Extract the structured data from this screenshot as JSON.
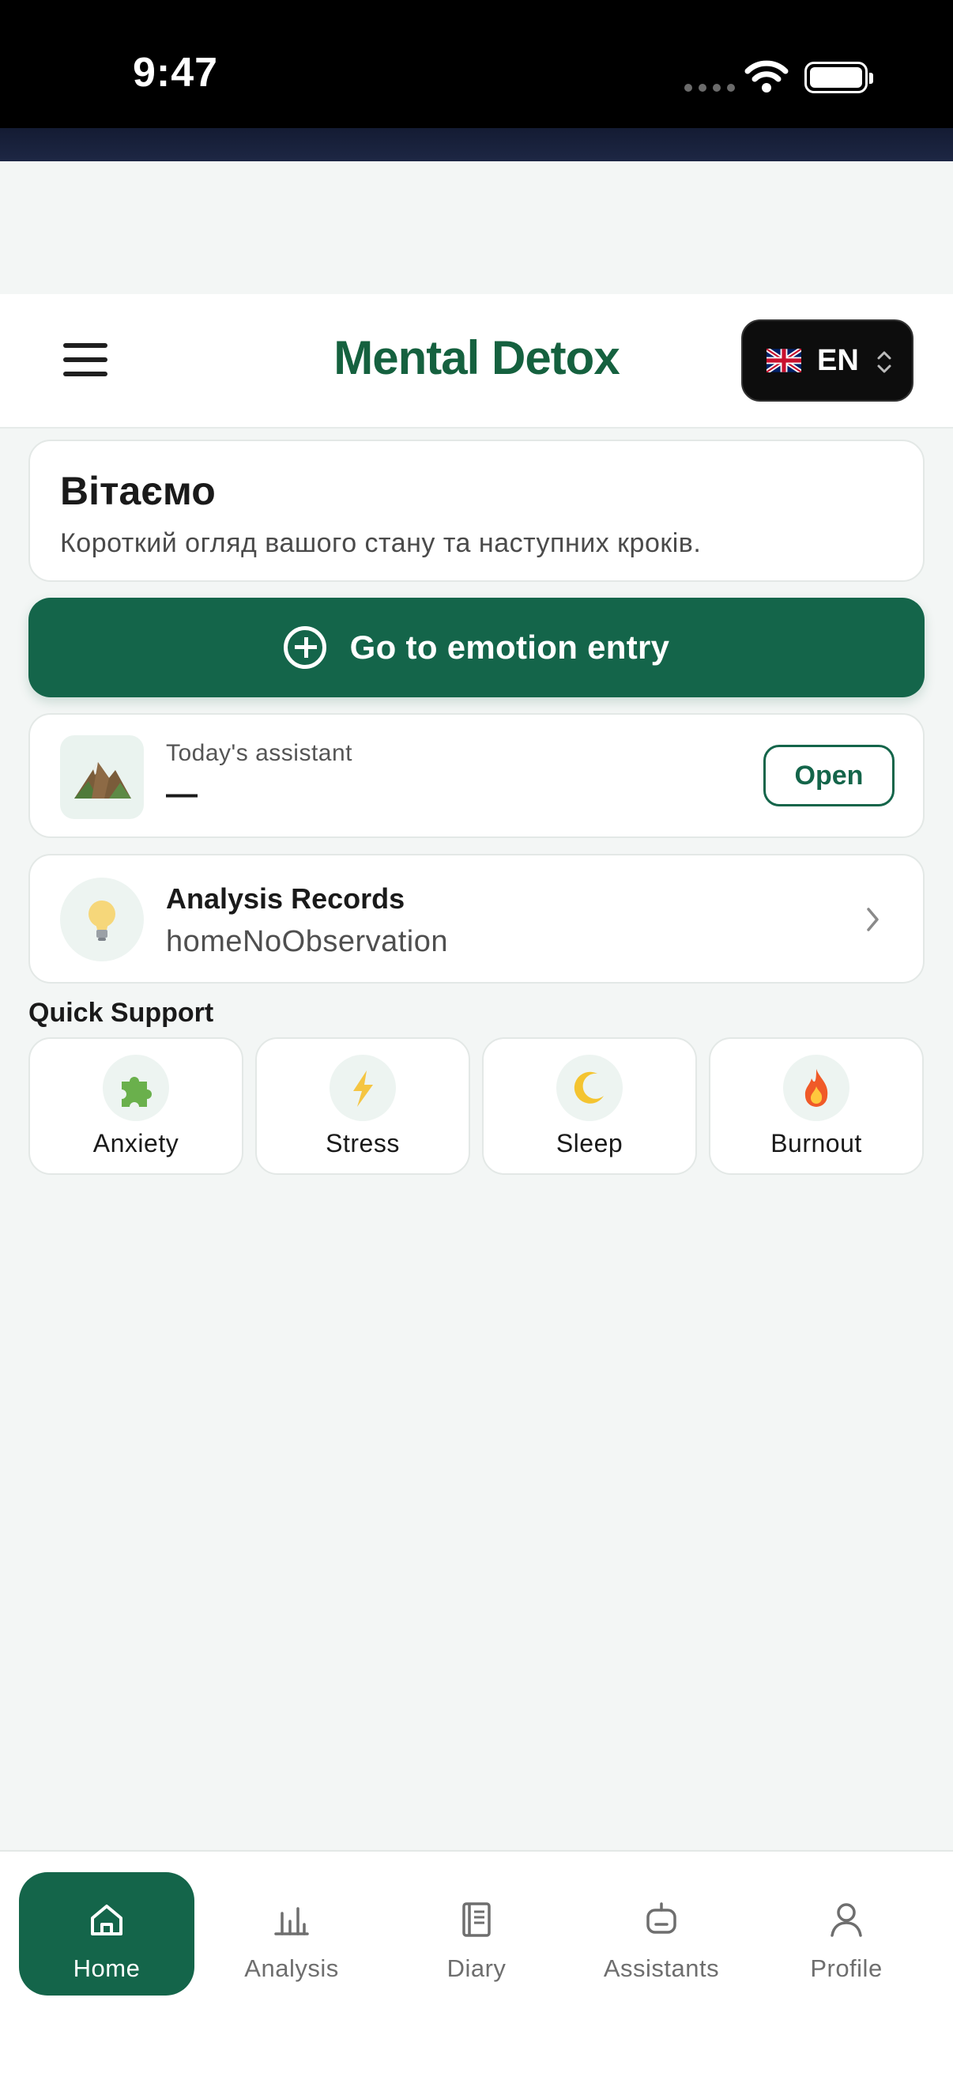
{
  "status_bar": {
    "time": "9:47"
  },
  "header": {
    "title": "Mental Detox",
    "language": {
      "code": "EN",
      "flag": "uk-flag-icon"
    }
  },
  "welcome": {
    "heading": "Вітаємо",
    "subtitle": "Короткий огляд вашого стану та наступних кроків."
  },
  "cta": {
    "label": "Go to emotion entry",
    "icon": "plus-circle-icon"
  },
  "assistant_card": {
    "label": "Today's assistant",
    "value": "—",
    "open_button": "Open",
    "icon": "mountain-icon"
  },
  "analysis_card": {
    "title": "Analysis Records",
    "subtitle": "homeNoObservation",
    "icon": "lightbulb-icon"
  },
  "quick_support": {
    "title": "Quick Support",
    "items": [
      {
        "label": "Anxiety",
        "icon": "puzzle-icon"
      },
      {
        "label": "Stress",
        "icon": "lightning-icon"
      },
      {
        "label": "Sleep",
        "icon": "moon-icon"
      },
      {
        "label": "Burnout",
        "icon": "fire-icon"
      }
    ]
  },
  "bottom_nav": {
    "items": [
      {
        "label": "Home",
        "icon": "home-icon",
        "active": true
      },
      {
        "label": "Analysis",
        "icon": "bar-chart-icon",
        "active": false
      },
      {
        "label": "Diary",
        "icon": "book-icon",
        "active": false
      },
      {
        "label": "Assistants",
        "icon": "robot-icon",
        "active": false
      },
      {
        "label": "Profile",
        "icon": "person-icon",
        "active": false
      }
    ]
  },
  "colors": {
    "brand": "#14654a",
    "title": "#15613f",
    "background": "#f3f6f5"
  }
}
